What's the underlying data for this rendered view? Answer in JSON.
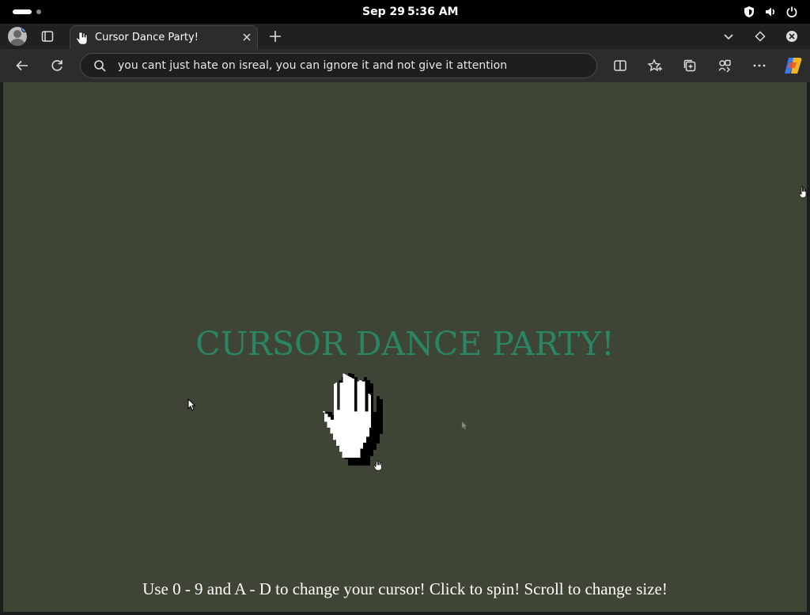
{
  "os": {
    "date": "Sep 29",
    "time": "5:36 AM",
    "tray_icons": [
      "shield-icon",
      "speaker-icon",
      "power-icon"
    ]
  },
  "browser": {
    "tab": {
      "title": "Cursor Dance Party!",
      "favicon": "hand-cursor-icon"
    },
    "address_bar": {
      "value": "you cant just hate on isreal, you can ignore it and not give it attention"
    },
    "toolbar_icons": [
      "back-icon",
      "refresh-icon",
      "split-screen-icon",
      "favorites-icon",
      "collections-icon",
      "browser-essentials-icon",
      "more-icon",
      "copilot-icon"
    ]
  },
  "page": {
    "title": "CURSOR DANCE PARTY!",
    "instructions": "Use 0 - 9 and A - D to change your cursor! Click to spin! Scroll to change size!",
    "background_color": "#3e4536",
    "title_color": "#2a8565"
  }
}
